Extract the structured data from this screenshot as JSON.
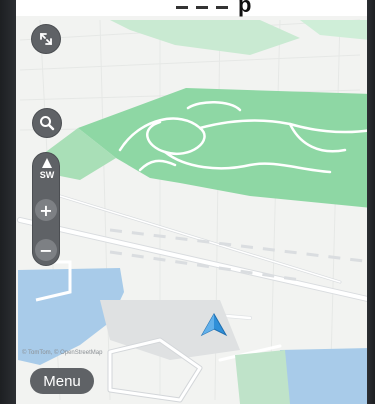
{
  "window": {
    "top_text": "p"
  },
  "map": {
    "attribution": "© TomTom, © OpenStreetMap",
    "colors": {
      "land": "#f4f5f3",
      "park": "#8ed7a4",
      "water": "#a8cbe9",
      "road": "#ffffff",
      "road_outline": "#d9dcdf",
      "path": "#ffffff",
      "position_arrow": "#2f8fd8"
    }
  },
  "controls": {
    "fullscreen_icon": "expand-arrows-icon",
    "search_icon": "magnifier-icon",
    "compass": {
      "heading": "SW",
      "icon": "north-arrow-icon"
    },
    "zoom_in_label": "+",
    "zoom_out_label": "−",
    "menu_label": "Menu"
  }
}
